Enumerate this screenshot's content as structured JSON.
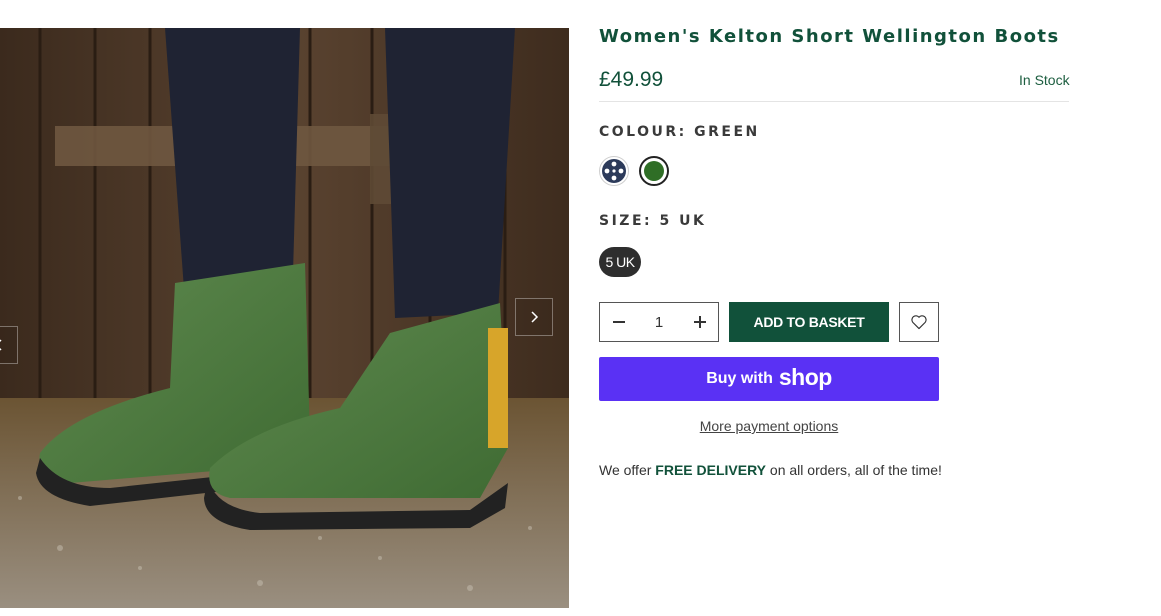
{
  "product": {
    "title": "Women's Kelton Short Wellington Boots",
    "price": "£49.99",
    "stock_status": "In Stock"
  },
  "colour": {
    "label": "COLOUR: GREEN",
    "swatches": [
      {
        "name": "navy-pattern",
        "color": "#2c3a5a"
      },
      {
        "name": "green",
        "color": "#2f6e26"
      }
    ]
  },
  "size": {
    "label": "SIZE: 5 UK",
    "options": [
      "5 UK"
    ]
  },
  "cart": {
    "quantity": "1",
    "add_label": "ADD TO BASKET",
    "wishlist_icon": "heart-icon",
    "shop_pay_prefix": "Buy with",
    "shop_pay_logo": "shop",
    "more_payment": "More payment options"
  },
  "delivery": {
    "prefix": "We offer ",
    "highlight": "FREE DELIVERY",
    "suffix": " on all orders, all of the time!"
  },
  "gallery": {
    "prev_icon": "chevron-left-icon",
    "next_icon": "chevron-right-icon"
  },
  "colors": {
    "brand_green": "#11513a",
    "shop_purple": "#5a31f4"
  }
}
